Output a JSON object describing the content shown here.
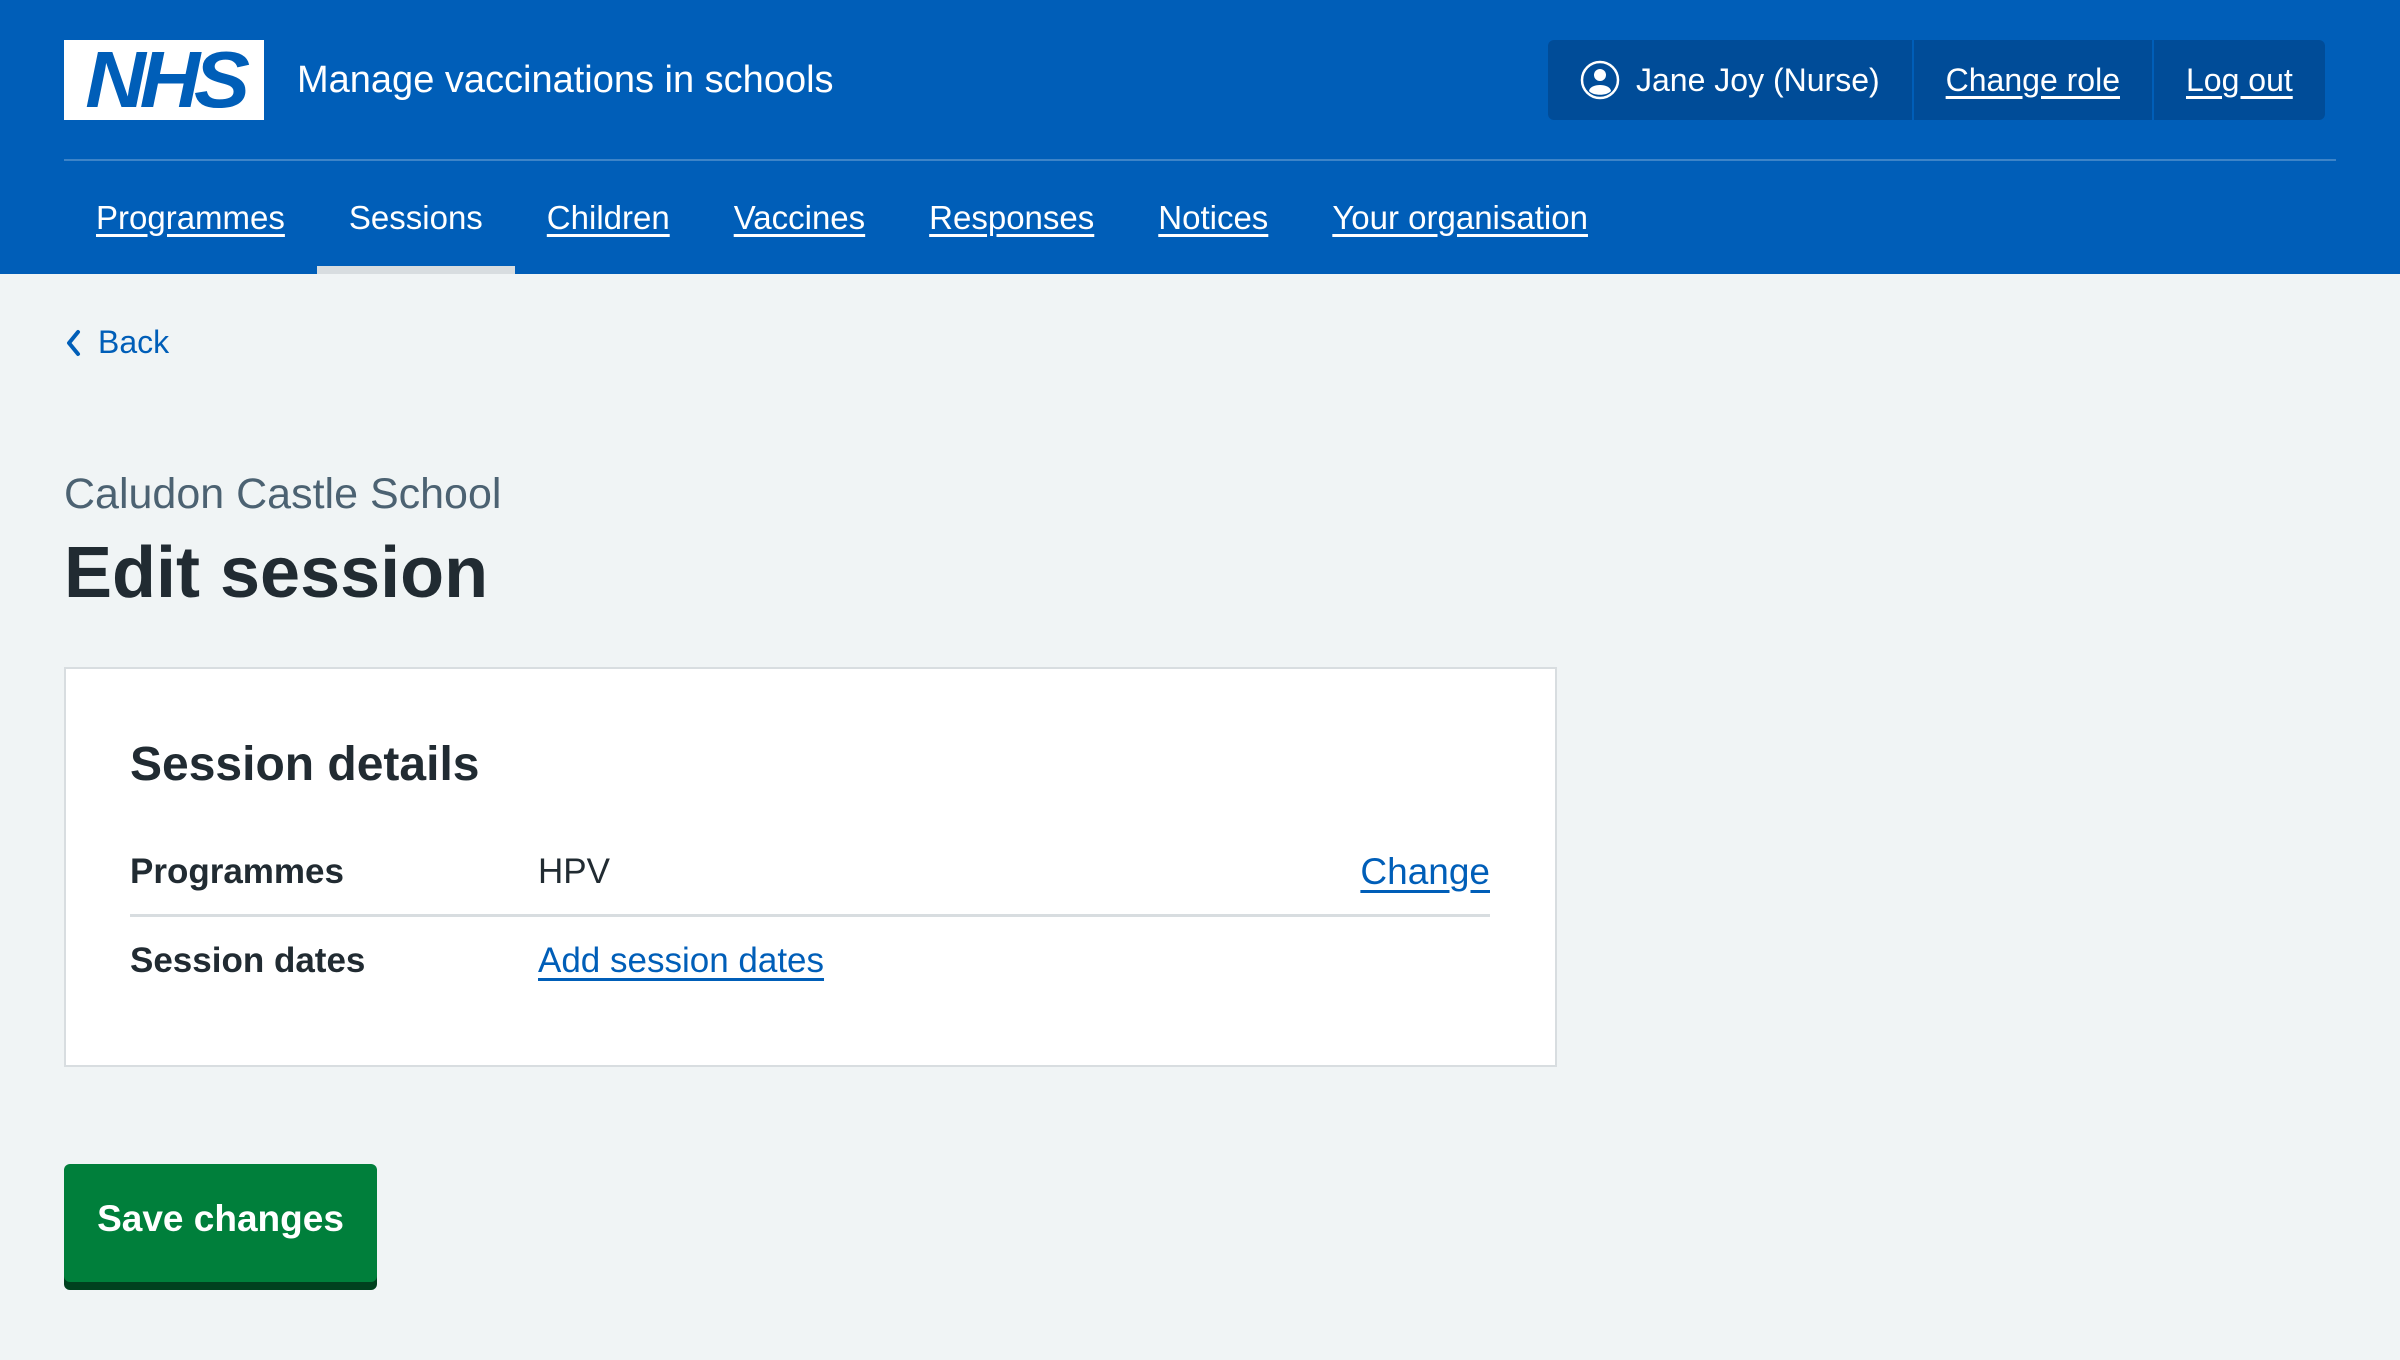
{
  "header": {
    "logo_text": "NHS",
    "service_name": "Manage vaccinations in schools",
    "account": {
      "user_label": "Jane Joy (Nurse)",
      "change_role_label": "Change role",
      "log_out_label": "Log out"
    },
    "nav": [
      {
        "label": "Programmes",
        "active": false
      },
      {
        "label": "Sessions",
        "active": true
      },
      {
        "label": "Children",
        "active": false
      },
      {
        "label": "Vaccines",
        "active": false
      },
      {
        "label": "Responses",
        "active": false
      },
      {
        "label": "Notices",
        "active": false
      },
      {
        "label": "Your organisation",
        "active": false
      }
    ]
  },
  "back_link": "Back",
  "page": {
    "caption": "Caludon Castle School",
    "title": "Edit session"
  },
  "card": {
    "title": "Session details",
    "rows": [
      {
        "key": "Programmes",
        "value": "HPV",
        "action": "Change"
      },
      {
        "key": "Session dates",
        "value_link": "Add session dates"
      }
    ]
  },
  "save_button": "Save changes",
  "colors": {
    "brand_blue": "#005eb8",
    "account_bg": "#004c98",
    "page_bg": "#f0f4f5",
    "button_green": "#007f3b",
    "text": "#212b32",
    "caption_grey": "#4c6272"
  }
}
